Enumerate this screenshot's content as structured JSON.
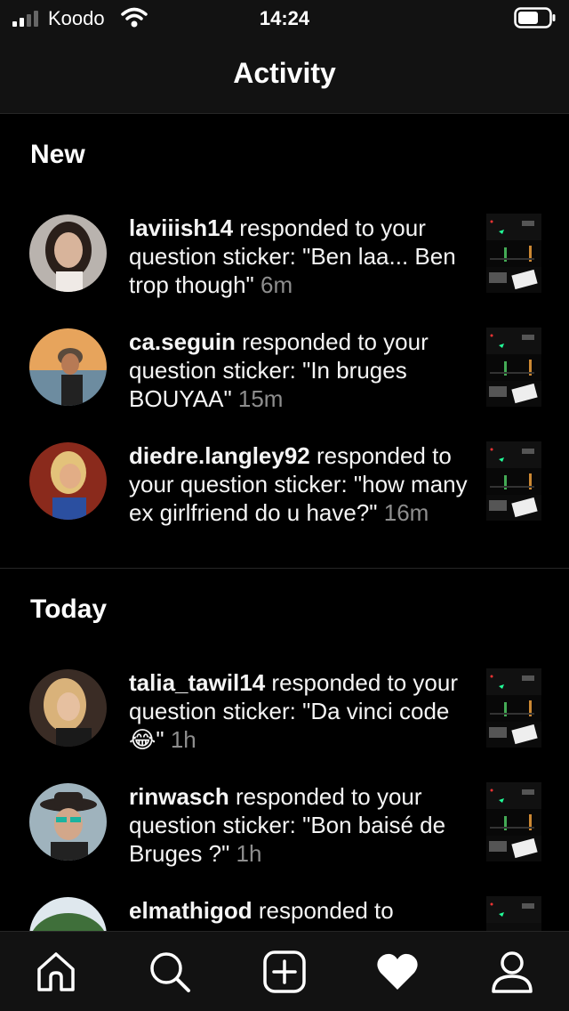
{
  "status_bar": {
    "carrier": "Koodo",
    "time": "14:24"
  },
  "header": {
    "title": "Activity"
  },
  "sections": [
    {
      "title": "New",
      "items": [
        {
          "username": "laviiish14",
          "action": " responded to your question sticker: \"Ben laa... Ben trop though\" ",
          "time": "6m"
        },
        {
          "username": "ca.seguin",
          "action": " responded to your question sticker: \"In bruges BOUYAA\" ",
          "time": "15m"
        },
        {
          "username": "diedre.langley92",
          "action": " responded to your question sticker: \"how many ex girlfriend do u have?\" ",
          "time": "16m"
        }
      ]
    },
    {
      "title": "Today",
      "items": [
        {
          "username": "talia_tawil14",
          "action": " responded to your question sticker: \"Da vinci code 😂\" ",
          "time": "1h"
        },
        {
          "username": "rinwasch",
          "action": " responded to your question sticker: \"Bon baisé de Bruges ?\" ",
          "time": "1h"
        },
        {
          "username": "elmathigod",
          "action": " responded to ",
          "time": ""
        }
      ]
    }
  ],
  "tab_bar": {
    "tabs": [
      {
        "icon": "home-icon"
      },
      {
        "icon": "search-icon"
      },
      {
        "icon": "add-post-icon"
      },
      {
        "icon": "heart-icon",
        "active": true
      },
      {
        "icon": "profile-icon"
      }
    ]
  },
  "colors": {
    "background": "#000000",
    "bar": "#121212",
    "muted_text": "#8e8e8e",
    "divider": "#262626"
  }
}
